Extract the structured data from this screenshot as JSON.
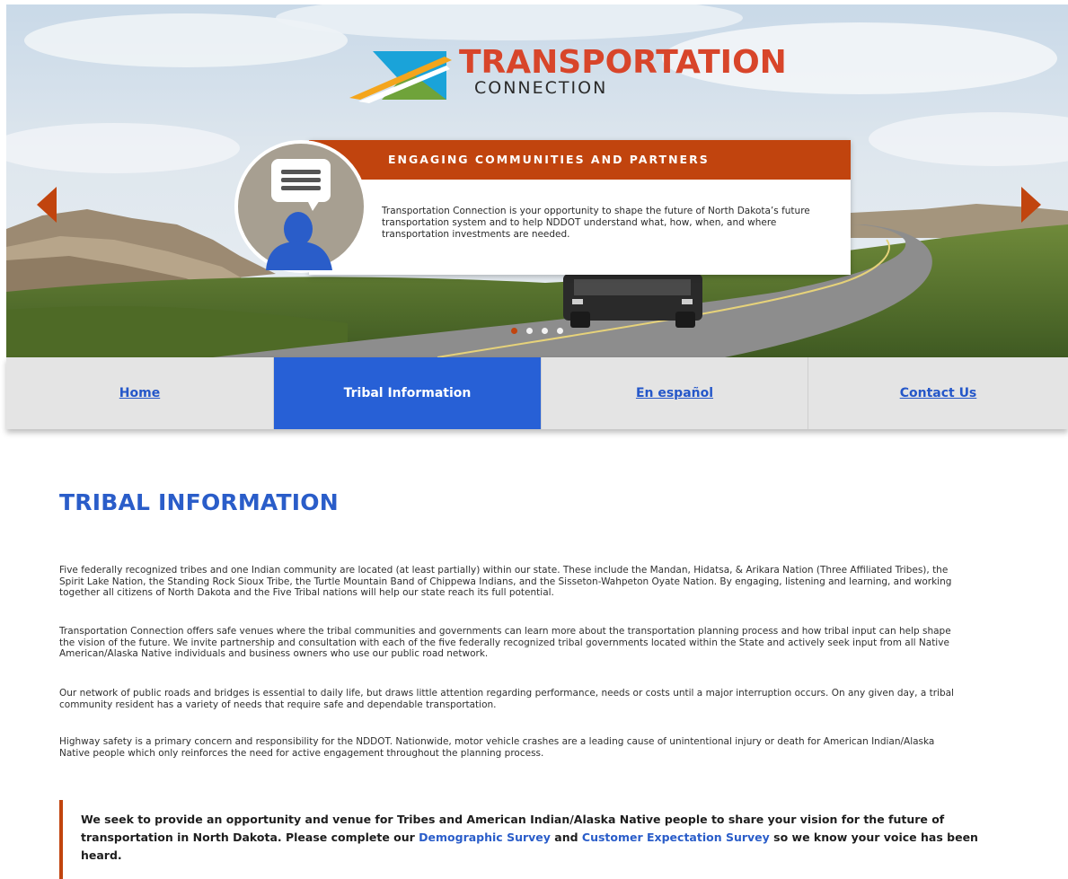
{
  "hero": {
    "logo": {
      "word_top": "TRANSPORTATION",
      "word_bottom": "CONNECTION"
    },
    "slide": {
      "heading": "ENGAGING COMMUNITIES AND PARTNERS",
      "text": "Transportation Connection is your opportunity to shape the future of North Dakota’s future transportation system and to help NDDOT understand what, how, when, and where transportation investments are needed."
    },
    "active_slide_index": 0,
    "slide_count": 4
  },
  "nav": {
    "items": [
      {
        "label": "Home",
        "active": false
      },
      {
        "label": "Tribal Information",
        "active": true
      },
      {
        "label": "En español",
        "active": false
      },
      {
        "label": "Contact Us",
        "active": false
      }
    ]
  },
  "main": {
    "title": "TRIBAL INFORMATION",
    "paragraphs": [
      "Five federally recognized tribes and one Indian community are located (at least partially) within our state. These include the Mandan, Hidatsa, & Arikara Nation (Three Affiliated Tribes), the Spirit Lake Nation, the Standing Rock Sioux Tribe, the Turtle Mountain Band of Chippewa Indians, and the Sisseton-Wahpeton Oyate Nation. By engaging, listening and learning, and working together all citizens of North Dakota and the Five Tribal nations will help our state reach its full potential.",
      "Transportation Connection offers safe venues where the tribal communities and governments can learn more about the transportation planning process and how tribal input can help shape the vision of the future. We invite partnership and consultation with each of the five federally recognized tribal governments located within the State and actively seek input from all Native American/Alaska Native individuals and business owners who use our public road network.",
      "Our network of public roads and bridges is essential to daily life, but draws little attention regarding performance, needs or costs until a major interruption occurs. On any given day, a tribal community resident has a variety of needs that require safe and dependable transportation.",
      "Highway safety is a primary concern and responsibility for the NDDOT. Nationwide, motor vehicle crashes are a leading cause of unintentional injury or death for American Indian/Alaska Native people which only reinforces the need for active engagement throughout the planning process."
    ],
    "callout": {
      "before": "We seek to provide an opportunity and venue for Tribes and American Indian/Alaska Native people to share your vision for the future of transportation in North Dakota. Please complete our ",
      "link1": "Demographic Survey",
      "middle": " and ",
      "link2": "Customer Expectation Survey",
      "after": " so we know your voice has been heard."
    }
  },
  "colors": {
    "accent_orange": "#c1440e",
    "nav_active_blue": "#2760d6",
    "title_blue": "#2a5dc9"
  },
  "icons": {
    "prev": "chevron-left-icon",
    "next": "chevron-right-icon",
    "avatar": "user-speech-bubble-icon"
  }
}
